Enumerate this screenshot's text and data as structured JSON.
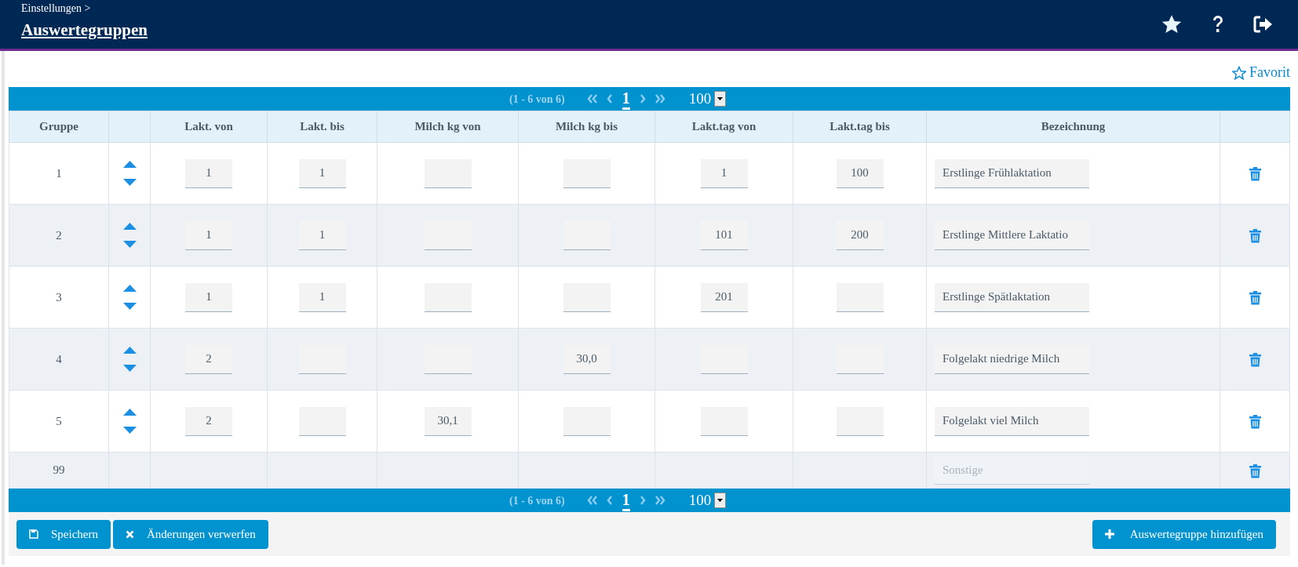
{
  "header": {
    "breadcrumb": "Einstellungen >",
    "title": "Auswertegruppen"
  },
  "favorite_link": "Favorit",
  "pager_top": {
    "range": "(1 - 6 von 6)",
    "page": "1",
    "page_size": "100"
  },
  "table": {
    "columns": [
      "Gruppe",
      "",
      "Lakt. von",
      "Lakt. bis",
      "Milch kg von",
      "Milch kg bis",
      "Lakt.tag von",
      "Lakt.tag bis",
      "Bezeichnung",
      ""
    ],
    "rows": [
      {
        "kind": "editable",
        "group": "1",
        "lakt_von": "1",
        "lakt_bis": "1",
        "lakt_tag_von": "1",
        "lakt_tag_bis": "100",
        "name": "Erstlinge Frühlaktation"
      },
      {
        "kind": "editable",
        "group": "2",
        "lakt_von": "1",
        "lakt_bis": "1",
        "lakt_tag_von": "101",
        "lakt_tag_bis": "200",
        "name": "Erstlinge Mittlere Laktatio"
      },
      {
        "kind": "editable",
        "group": "3",
        "lakt_von": "1",
        "lakt_bis": "1",
        "lakt_tag_von": "201",
        "name": "Erstlinge Spätlaktation"
      },
      {
        "kind": "editable",
        "group": "4",
        "lakt_von": "2",
        "milch_kg_bis": "30,0",
        "name": "Folgelakt niedrige Milch"
      },
      {
        "kind": "editable",
        "group": "5",
        "lakt_von": "2",
        "milch_kg_von": "30,1",
        "name": "Folgelakt viel Milch"
      },
      {
        "kind": "fixed",
        "group": "99",
        "placeholder": "Sonstige"
      }
    ]
  },
  "pager_bottom": {
    "range": "(1 - 6 von 6)",
    "page": "1",
    "page_size": "100"
  },
  "buttons": {
    "save": "Speichern",
    "discard": "Änderungen verwerfen",
    "add": "Auswertegruppe hinzufügen"
  }
}
